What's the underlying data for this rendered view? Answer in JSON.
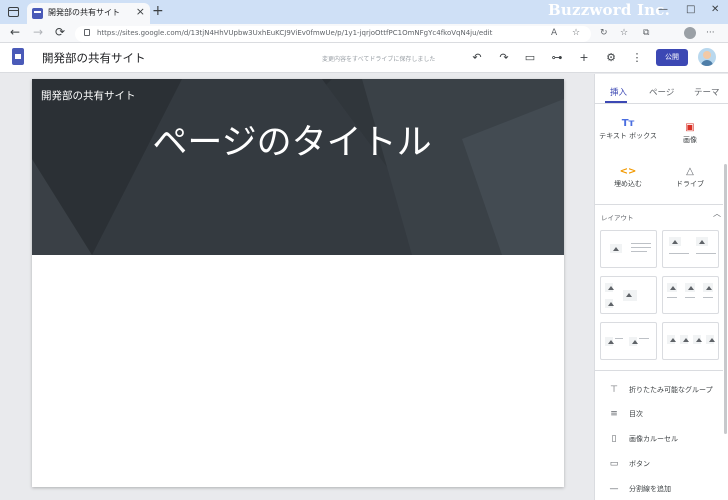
{
  "browser": {
    "tab_title": "開発部の共有サイト",
    "tab_close": "×",
    "new_tab": "+",
    "brand": "Buzzword Inc.",
    "window_controls": [
      "—",
      "□",
      "✕"
    ],
    "url": "https://sites.google.com/d/13tjN4HhVUpbw3UxhEuKCJ9ViEv0fmwUe/p/1y1-jqrjoOttfPC1OmNFgYc4fkoVqN4ju/edit",
    "nav": {
      "back": "←",
      "forward": "→",
      "reload": "⟳"
    },
    "url_icons": [
      "A",
      "☆"
    ],
    "toolbar_icons": [
      "↻",
      "☆",
      "⧉",
      "···"
    ]
  },
  "sites": {
    "site_name": "開発部の共有サイト",
    "saved_status": "変更内容をすべてドライブに保存しました",
    "tools": {
      "undo": "↶",
      "redo": "↷",
      "preview": "▭",
      "link": "⊶",
      "share": "+",
      "settings": "⚙",
      "more": "⋮"
    },
    "publish_label": "公開"
  },
  "page": {
    "banner_site_name": "開発部の共有サイト",
    "title": "ページのタイトル"
  },
  "panel": {
    "tabs": [
      "挿入",
      "ページ",
      "テーマ"
    ],
    "insert_items": [
      {
        "icon": "Tт",
        "label": "テキスト ボックス",
        "color": "#4a6ee0"
      },
      {
        "icon": "▣",
        "label": "画像",
        "color": "#d93025"
      },
      {
        "icon": "<>",
        "label": "埋め込む",
        "color": "#f29900"
      },
      {
        "icon": "△",
        "label": "ドライブ",
        "color": "#5f6368"
      }
    ],
    "layout_heading": "レイアウト",
    "layout_toggle": "︿",
    "elements": [
      {
        "icon": "⊤",
        "label": "折りたたみ可能なグループ"
      },
      {
        "icon": "≡",
        "label": "目次"
      },
      {
        "icon": "▯",
        "label": "画像カルーセル"
      },
      {
        "icon": "▭",
        "label": "ボタン"
      },
      {
        "icon": "—",
        "label": "分割線を追加"
      }
    ]
  }
}
